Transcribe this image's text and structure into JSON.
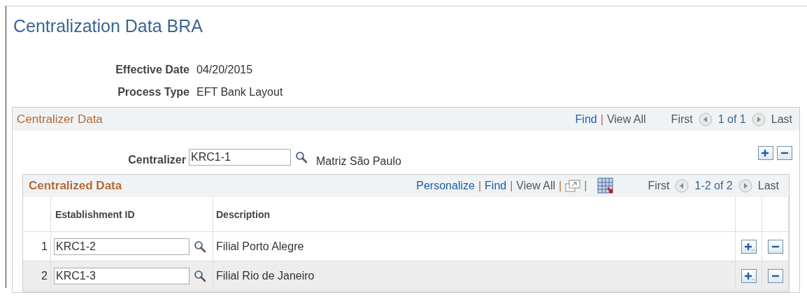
{
  "title": "Centralization Data BRA",
  "fields": [
    {
      "label": "Effective Date",
      "value": "04/20/2015"
    },
    {
      "label": "Process Type",
      "value": "EFT Bank Layout"
    }
  ],
  "centralizer_data": {
    "title": "Centralizer Data",
    "find": "Find",
    "separators": [
      "|"
    ],
    "view_all": "View All",
    "first": "First",
    "range": "1 of 1",
    "last": "Last",
    "centralizer": {
      "label": "Centralizer",
      "value": "KRC1-1",
      "description": "Matriz São Paulo"
    },
    "grid": {
      "title": "Centralized Data",
      "separators": [
        "|",
        "|",
        "|",
        "|"
      ],
      "personalize": "Personalize",
      "find": "Find",
      "view_all": "View All",
      "first": "First",
      "range": "1-2 of 2",
      "last": "Last",
      "columns": [
        "Establishment ID",
        "Description"
      ],
      "rows": [
        {
          "number": "1",
          "establishment_id": "KRC1-2",
          "description": "Filial Porto Alegre"
        },
        {
          "number": "2",
          "establishment_id": "KRC1-3",
          "description": "Filial Rio de Janeiro"
        }
      ]
    }
  }
}
